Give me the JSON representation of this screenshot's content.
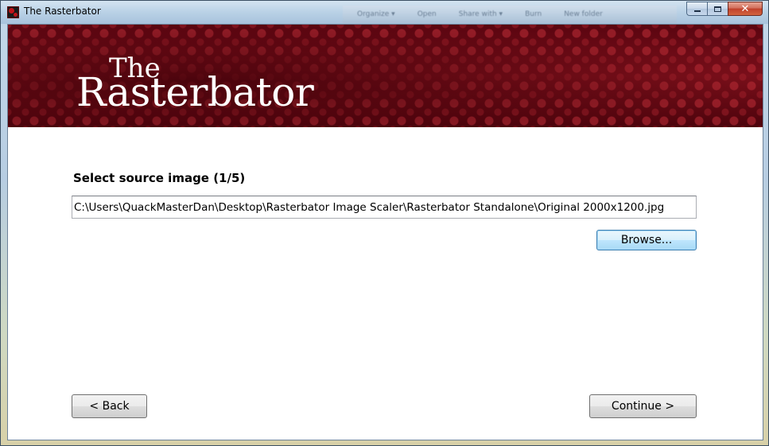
{
  "window": {
    "title": "The Rasterbator",
    "background_toolbar_items": [
      "Organize ▾",
      "Open",
      "Share with ▾",
      "Burn",
      "New folder"
    ]
  },
  "caption_buttons": {
    "minimize": "minimize",
    "maximize": "maximize",
    "close": "✕"
  },
  "banner": {
    "logo_the": "The",
    "logo_main": "Rasterbator",
    "colors": {
      "banner": "#6a0a14",
      "dots": "#be2d37"
    }
  },
  "wizard": {
    "heading": "Select source image (1/5)",
    "source_path": "C:\\Users\\QuackMasterDan\\Desktop\\Rasterbator Image Scaler\\Rasterbator Standalone\\Original 2000x1200.jpg",
    "browse_label": "Browse...",
    "back_label": "< Back",
    "continue_label": "Continue >"
  }
}
